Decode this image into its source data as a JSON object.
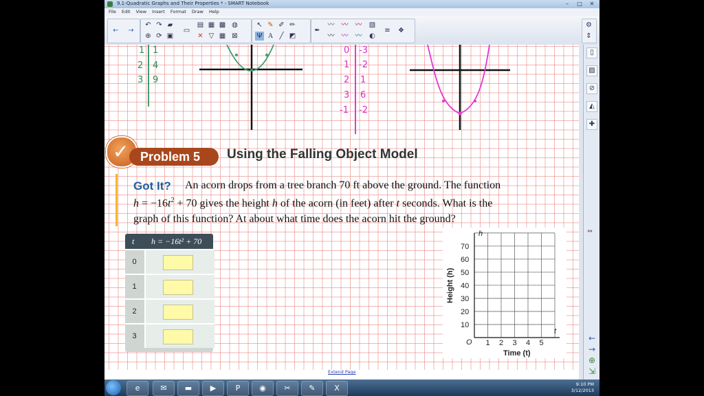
{
  "window": {
    "title": "9.1-Quadratic Graphs and Their Properties * - SMART Notebook",
    "controls": [
      "–",
      "□",
      "✕"
    ]
  },
  "menu": [
    "File",
    "Edit",
    "View",
    "Insert",
    "Format",
    "Draw",
    "Help"
  ],
  "problem": {
    "badge": "Problem 5",
    "title": "Using the Falling Object Model"
  },
  "got_it": {
    "label": "Got It?",
    "line1": "An acorn drops from a tree branch 70 ft above the ground. The function",
    "line2_var": "h",
    "line2_eq": " = −16",
    "line2_t": "t",
    "line2_exp": "2",
    "line2_rest_a": " + 70 gives the height ",
    "line2_h": "h",
    "line2_rest_b": " of the acorn (in feet) after ",
    "line2_t2": "t",
    "line2_rest_c": " seconds. What is the",
    "line3": "graph of this function? At about what time does the acorn hit the ground?"
  },
  "table": {
    "col1": "t",
    "col2": "h = −16t² + 70",
    "rows": [
      "0",
      "1",
      "2",
      "3"
    ]
  },
  "graph": {
    "y_axis_label": "Height (h)",
    "x_axis_label": "Time (t)",
    "y_var": "h",
    "x_var": "t",
    "origin": "O",
    "y_ticks": [
      "10",
      "20",
      "30",
      "40",
      "50",
      "60",
      "70"
    ],
    "x_ticks": [
      "1",
      "2",
      "3",
      "4",
      "5"
    ]
  },
  "handwritten_top": {
    "table1": [
      [
        "1",
        "1"
      ],
      [
        "2",
        "4"
      ],
      [
        "3",
        "9"
      ]
    ],
    "table2": [
      [
        "0",
        "-3"
      ],
      [
        "1",
        "-2"
      ],
      [
        "2",
        "1"
      ],
      [
        "3",
        "6"
      ],
      [
        "-1",
        "-2"
      ]
    ]
  },
  "footer": {
    "extend_page": "Extend Page"
  },
  "taskbar": {
    "time": "9:10 PM",
    "date": "3/12/2013"
  },
  "colors": {
    "accent_orange": "#a9471c",
    "gotit_blue": "#1d5f9e",
    "grid_red": "#e87878",
    "ink_green": "#3d9e6e",
    "ink_magenta": "#e23ad0"
  }
}
